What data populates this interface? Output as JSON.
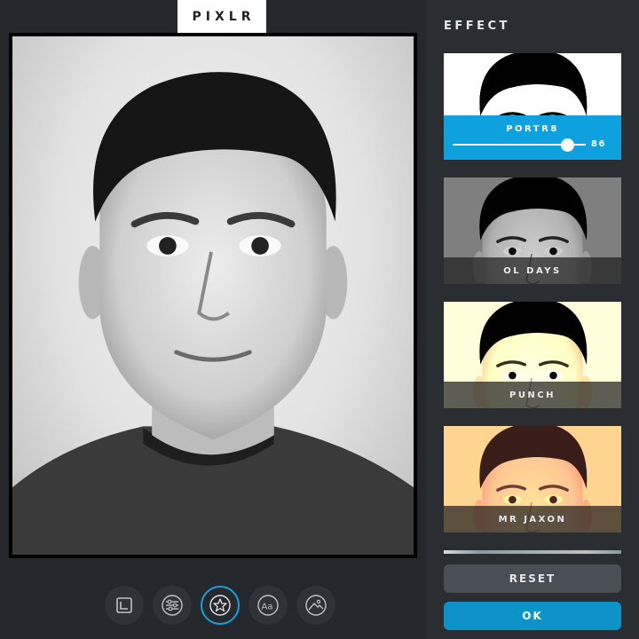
{
  "app": {
    "logo": "PIXLR"
  },
  "panel": {
    "title": "EFFECT"
  },
  "effects": [
    {
      "label": "PORTR8",
      "selected": true,
      "intensity": 86
    },
    {
      "label": "OL DAYS",
      "selected": false
    },
    {
      "label": "PUNCH",
      "selected": false
    },
    {
      "label": "MR JAXON",
      "selected": false
    }
  ],
  "selected_value_text": "86",
  "toolbar": [
    {
      "icon": "crop-icon",
      "active": false
    },
    {
      "icon": "adjust-sliders-icon",
      "active": false
    },
    {
      "icon": "effect-star-icon",
      "active": true
    },
    {
      "icon": "text-icon",
      "active": false
    },
    {
      "icon": "overlay-landscape-icon",
      "active": false
    }
  ],
  "buttons": {
    "reset": "RESET",
    "ok": "OK"
  },
  "colors": {
    "accent": "#0ea1dd",
    "ok": "#0e93c9",
    "reset": "#4a4e56",
    "panel": "#2a2d32",
    "background": "#24272c"
  }
}
